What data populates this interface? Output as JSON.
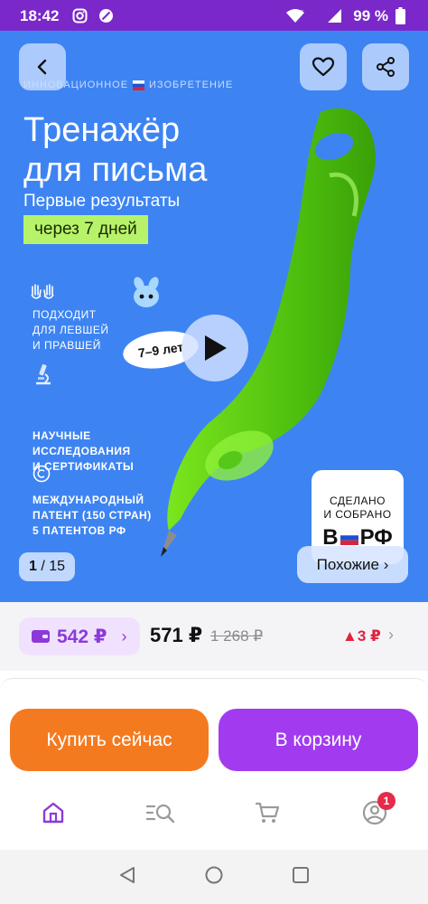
{
  "status_bar": {
    "time": "18:42",
    "battery": "99 %",
    "icons": [
      "instagram-icon",
      "blocked-app-icon",
      "wifi-icon",
      "signal-icon",
      "battery-icon"
    ]
  },
  "hero": {
    "tagline_left": "ИННОВАЦИОННОЕ",
    "tagline_right": "ИЗОБРЕТЕНИЕ",
    "title_line1": "Тренажёр",
    "title_line2": "для письма",
    "subtitle": "Первые результаты",
    "highlight": "через 7 дней",
    "features": [
      {
        "icon": "hands-icon",
        "lines": [
          "ПОДХОДИТ",
          "ДЛЯ ЛЕВШЕЙ",
          "И ПРАВШЕЙ"
        ]
      },
      {
        "icon": "microscope-icon",
        "lines": [
          "НАУЧНЫЕ",
          "ИССЛЕДОВАНИЯ",
          "И СЕРТИФИКАТЫ"
        ]
      },
      {
        "icon": "copyright-icon",
        "lines": [
          "МЕЖДУНАРОДНЫЙ",
          "ПАТЕНТ (150 СТРАН)",
          "5 ПАТЕНТОВ РФ"
        ]
      }
    ],
    "age_badge": "7–9 лет",
    "made_in": {
      "line1": "СДЕЛАНО",
      "line2": "И СОБРАНО",
      "big_left": "В",
      "big_right": "РФ"
    },
    "counter_current": "1",
    "counter_total": "/ 15",
    "similar_label": "Похожие ›"
  },
  "price_row": {
    "wallet_price": "542 ₽",
    "wallet_chevron": "›",
    "price": "571 ₽",
    "old_price": "1 268 ₽",
    "delta": "▲3 ₽",
    "chevron": "›"
  },
  "actions": {
    "buy_now": "Купить сейчас",
    "add_to_cart": "В корзину"
  },
  "tab_bar": {
    "items": [
      "home-icon",
      "catalog-search-icon",
      "cart-icon",
      "profile-icon"
    ],
    "profile_badge": "1"
  },
  "colors": {
    "status_bar": "#7a28c9",
    "hero_bg": "#3d84f2",
    "highlight": "#b7f36a",
    "buy": "#f47a20",
    "cart": "#a23bf0",
    "wallet_price": "#8b3ad9",
    "delta": "#e0233d"
  }
}
